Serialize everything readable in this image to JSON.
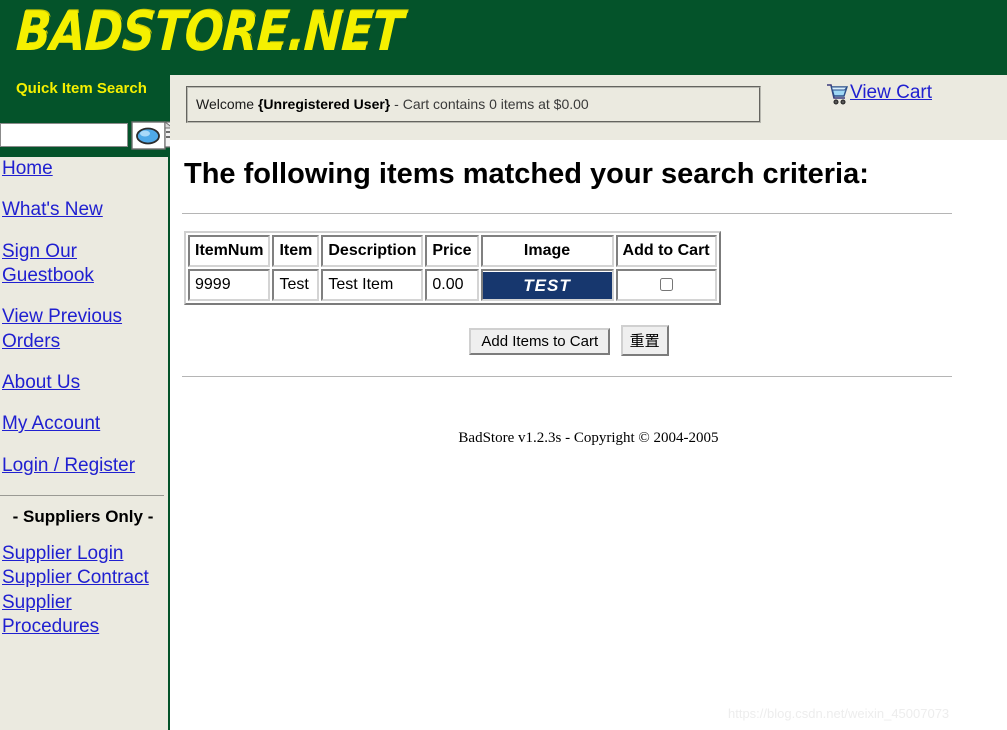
{
  "site": {
    "logo_text": "BADSTORE.NET",
    "brand_green": "#04532a",
    "brand_yellow": "#f5f000",
    "link_blue": "#2020d0",
    "panel_beige": "#ebeae0"
  },
  "sidebar": {
    "search_label": "Quick Item Search",
    "search_value": "",
    "search_placeholder": "",
    "search_icon": "magnifier-document-icon",
    "nav_items": [
      {
        "label": "Home"
      },
      {
        "label": "What's New"
      },
      {
        "label": "Sign Our Guestbook"
      },
      {
        "label": "View Previous Orders"
      },
      {
        "label": "About Us"
      },
      {
        "label": "My Account"
      },
      {
        "label": "Login / Register"
      }
    ],
    "suppliers_heading": "- Suppliers Only -",
    "supplier_items": [
      {
        "label": "Supplier Login"
      },
      {
        "label": "Supplier Contract"
      },
      {
        "label": "Supplier Procedures"
      }
    ]
  },
  "header": {
    "welcome_prefix": "Welcome ",
    "welcome_user": "{Unregistered User}",
    "welcome_suffix": " - Cart contains 0 items at $0.00",
    "view_cart_label": "View Cart",
    "cart_icon": "shopping-cart-icon"
  },
  "main": {
    "page_title": "The following items matched your search criteria:",
    "table": {
      "columns": [
        "ItemNum",
        "Item",
        "Description",
        "Price",
        "Image",
        "Add to Cart"
      ],
      "rows": [
        {
          "itemnum": "9999",
          "item": "Test",
          "description": "Test Item",
          "price": "0.00",
          "image_label": "TEST",
          "image_bg": "#17376e",
          "add_to_cart_checked": false
        }
      ]
    },
    "buttons": {
      "submit_label": "Add Items to Cart",
      "reset_label": "重置"
    }
  },
  "footer": {
    "copyright": "BadStore v1.2.3s - Copyright © 2004-2005"
  },
  "watermark": {
    "text": "https://blog.csdn.net/weixin_45007073"
  }
}
